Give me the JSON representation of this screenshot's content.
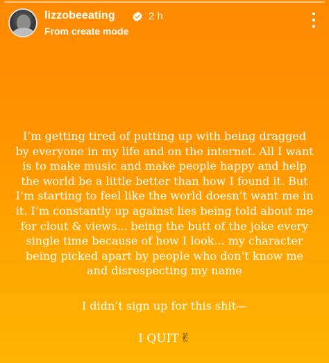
{
  "header": {
    "username": "lizzobeeating",
    "verified_icon": "verified-badge-icon",
    "time_ago": "2 h",
    "subtitle": "From create mode",
    "more_icon": "more-vertical-icon"
  },
  "story": {
    "paragraph": "I’m getting tired of putting up with being dragged by everyone in my life and on the internet. All I want is to make music and make people happy and help the world be a little better than how I found it. But I’m starting to feel like the world doesn’t want me in it. I’m constantly up against lies being told about me for clout & views... being the butt of the joke every single time because of how I look... my character being picked apart by people who don’t know me and disrespecting my name",
    "line2": "I didn’t sign up for this shit—",
    "line3": "I QUIT",
    "emoji": "✌"
  },
  "colors": {
    "gradient_top": "#ff8a00",
    "gradient_bottom": "#ffb400",
    "text": "#ffffff"
  }
}
